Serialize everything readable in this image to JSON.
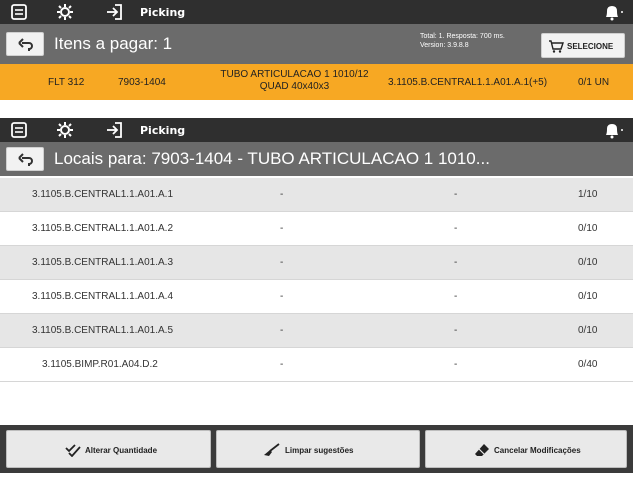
{
  "topbar": {
    "title": "Picking"
  },
  "top_screen": {
    "header_title": "Itens a pagar: 1",
    "total_line": "Total: 1. Resposta: 700 ms.",
    "version_line": "Version: 3.9.8.8",
    "select_button": "SELECIONE",
    "item": {
      "code": "FLT 312",
      "sku": "7903-1404",
      "description_line1": "TUBO ARTICULACAO 1 1010/12",
      "description_line2": "QUAD 40x40x3",
      "location": "3.1105.B.CENTRAL1.1.A01.A.1(+5)",
      "qty": "0/1 UN"
    }
  },
  "bottom_screen": {
    "header_title": "Locais para: 7903-1404 - TUBO ARTICULACAO 1 1010...",
    "rows": [
      {
        "location": "3.1105.B.CENTRAL1.1.A01.A.1",
        "c2": "-",
        "c3": "-",
        "qty": "1/10"
      },
      {
        "location": "3.1105.B.CENTRAL1.1.A01.A.2",
        "c2": "-",
        "c3": "-",
        "qty": "0/10"
      },
      {
        "location": "3.1105.B.CENTRAL1.1.A01.A.3",
        "c2": "-",
        "c3": "-",
        "qty": "0/10"
      },
      {
        "location": "3.1105.B.CENTRAL1.1.A01.A.4",
        "c2": "-",
        "c3": "-",
        "qty": "0/10"
      },
      {
        "location": "3.1105.B.CENTRAL1.1.A01.A.5",
        "c2": "-",
        "c3": "-",
        "qty": "0/10"
      },
      {
        "location": "3.1105.BIMP.R01.A04.D.2",
        "c2": "-",
        "c3": "-",
        "qty": "0/40"
      }
    ],
    "buttons": {
      "alter": "Alterar Quantidade",
      "clear": "Limpar sugestões",
      "cancel": "Cancelar Modificações"
    }
  },
  "colors": {
    "topbar": "#2f2f2f",
    "header": "#6b6b6b",
    "highlight": "#f7a823",
    "row_alt": "#e6e6e6"
  },
  "icons": [
    "menu-icon",
    "settings-gear-icon",
    "logout-icon",
    "notification-bell-icon",
    "back-arrow-icon",
    "cart-icon",
    "double-check-icon",
    "broom-icon",
    "eraser-icon"
  ]
}
